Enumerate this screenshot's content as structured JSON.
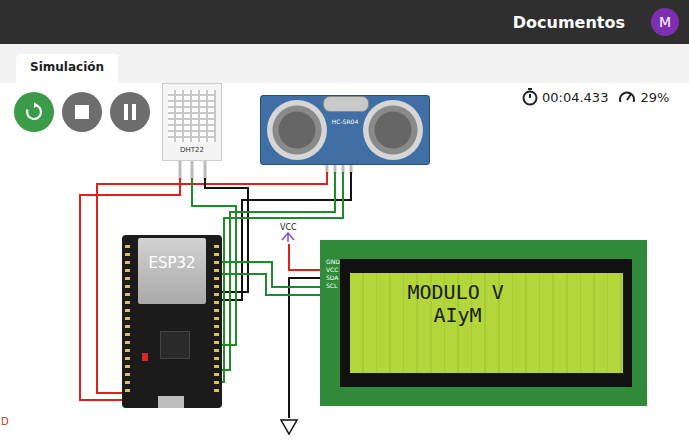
{
  "top_bar": {
    "title": "Documentos",
    "avatar": "M"
  },
  "tabs": [
    {
      "label": "Simulación",
      "selected": true
    }
  ],
  "controls": [
    {
      "kind": "restart",
      "active": true
    },
    {
      "kind": "stop",
      "active": false
    },
    {
      "kind": "pause",
      "active": false
    }
  ],
  "status": {
    "timer": "00:04.433",
    "speed": "29%"
  },
  "parts": {
    "dht": "DHT22",
    "ultrasonic": "HC-SR04",
    "mcu": "ESP32",
    "power": "VCC",
    "edge_label": "D"
  },
  "lcd": {
    "lines": [
      "MODULO V",
      "AIyM"
    ],
    "pins": [
      "GND",
      "VCC",
      "SDA",
      "SCL"
    ]
  },
  "wires": [
    {
      "color": "#e0201b"
    },
    {
      "color": "#e0201b"
    },
    {
      "color": "#111111"
    },
    {
      "color": "#111111"
    },
    {
      "color": "#1f8a2a"
    },
    {
      "color": "#1f8a2a"
    },
    {
      "color": "#1f8a2a"
    },
    {
      "color": "#e0201b"
    },
    {
      "color": "#111111"
    },
    {
      "color": "#1f8a2a"
    },
    {
      "color": "#1f8a2a"
    }
  ]
}
